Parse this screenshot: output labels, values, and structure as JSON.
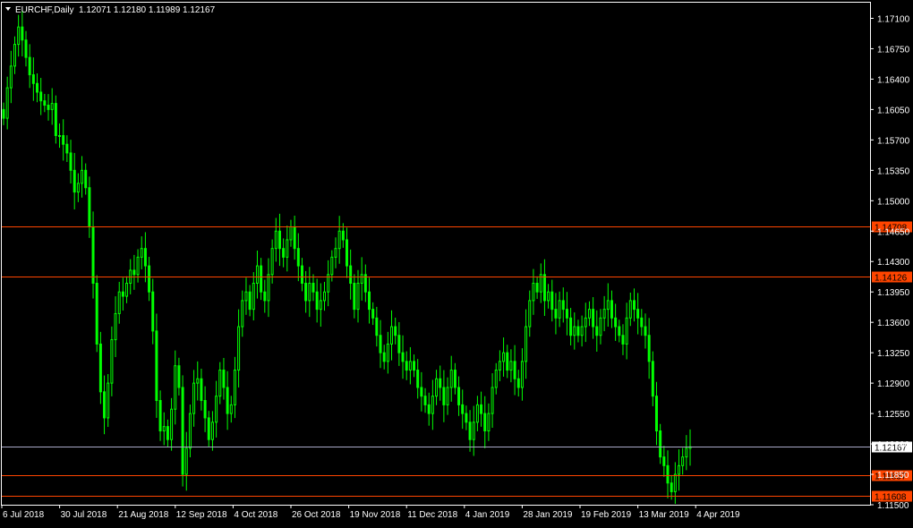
{
  "header": {
    "symbol_label": "EURCHF,Daily",
    "ohlc": "1.12071 1.12180 1.11989 1.12167"
  },
  "colors": {
    "background": "#000000",
    "frame": "#ffffff",
    "candle": "#00ff00",
    "text": "#ffffff",
    "resistance_line": "#ff4500",
    "current_price_line": "#a9a9c8",
    "tag_fill": "#ff4500",
    "current_tag_fill": "#ffffff"
  },
  "chart_data": {
    "type": "candlestick",
    "symbol": "EURCHF",
    "timeframe": "Daily",
    "ylim": [
      1.115,
      1.1728
    ],
    "y_ticks": [
      "1.17100",
      "1.16750",
      "1.16400",
      "1.16050",
      "1.15700",
      "1.15350",
      "1.15000",
      "1.14650",
      "1.14300",
      "1.13950",
      "1.13600",
      "1.13250",
      "1.12900",
      "1.12550",
      "1.12200",
      "1.11850",
      "1.11500"
    ],
    "x_ticks": [
      "6 Jul 2018",
      "30 Jul 2018",
      "21 Aug 2018",
      "12 Sep 2018",
      "4 Oct 2018",
      "26 Oct 2018",
      "19 Nov 2018",
      "11 Dec 2018",
      "4 Jan 2019",
      "28 Jan 2019",
      "19 Feb 2019",
      "13 Mar 2019",
      "4 Apr 2019"
    ],
    "horizontal_lines": [
      {
        "label": "1.14708",
        "price": 1.14708,
        "kind": "resistance"
      },
      {
        "label": "1.14126",
        "price": 1.14126,
        "kind": "resistance"
      },
      {
        "label": "1.12167",
        "price": 1.12167,
        "kind": "current"
      },
      {
        "label": "1.11837",
        "price": 1.11837,
        "kind": "support"
      },
      {
        "label": "1.11608",
        "price": 1.11608,
        "kind": "support"
      }
    ],
    "closes": [
      1.1595,
      1.163,
      1.1655,
      1.168,
      1.17,
      1.1685,
      1.1665,
      1.1645,
      1.1635,
      1.1625,
      1.1615,
      1.161,
      1.1605,
      1.1612,
      1.1575,
      1.1575,
      1.1565,
      1.1555,
      1.1535,
      1.151,
      1.152,
      1.1535,
      1.1515,
      1.147,
      1.1405,
      1.1335,
      1.128,
      1.125,
      1.129,
      1.134,
      1.137,
      1.1395,
      1.139,
      1.1405,
      1.142,
      1.1415,
      1.1435,
      1.1445,
      1.1425,
      1.1395,
      1.135,
      1.127,
      1.1235,
      1.124,
      1.1225,
      1.126,
      1.131,
      1.1285,
      1.1185,
      1.1215,
      1.1255,
      1.129,
      1.1295,
      1.127,
      1.125,
      1.1225,
      1.1245,
      1.1275,
      1.1305,
      1.1285,
      1.1255,
      1.1265,
      1.1305,
      1.1355,
      1.1385,
      1.1395,
      1.1375,
      1.1405,
      1.1425,
      1.1395,
      1.1385,
      1.1415,
      1.1445,
      1.1465,
      1.1445,
      1.1435,
      1.1455,
      1.147,
      1.1445,
      1.1425,
      1.1405,
      1.1385,
      1.1405,
      1.1395,
      1.1375,
      1.1385,
      1.1395,
      1.1415,
      1.1435,
      1.1445,
      1.1465,
      1.1455,
      1.1425,
      1.1405,
      1.1375,
      1.1405,
      1.1415,
      1.1395,
      1.1375,
      1.1365,
      1.1345,
      1.1325,
      1.1315,
      1.1335,
      1.1355,
      1.1345,
      1.1325,
      1.1315,
      1.1305,
      1.1315,
      1.1305,
      1.1285,
      1.1275,
      1.1265,
      1.1255,
      1.1275,
      1.1295,
      1.1285,
      1.1265,
      1.1285,
      1.1305,
      1.1285,
      1.1265,
      1.1255,
      1.1245,
      1.1225,
      1.1245,
      1.1265,
      1.1255,
      1.1235,
      1.1255,
      1.1285,
      1.1305,
      1.1315,
      1.1325,
      1.1305,
      1.1315,
      1.1295,
      1.1285,
      1.1315,
      1.1355,
      1.1385,
      1.1405,
      1.1395,
      1.1415,
      1.1385,
      1.1395,
      1.1375,
      1.1365,
      1.1385,
      1.1375,
      1.1365,
      1.1345,
      1.1355,
      1.1345,
      1.1355,
      1.1365,
      1.1375,
      1.1355,
      1.1345,
      1.1365,
      1.1375,
      1.1385,
      1.1365,
      1.1355,
      1.1345,
      1.1335,
      1.1365,
      1.1385,
      1.1375,
      1.1365,
      1.1355,
      1.1345,
      1.1315,
      1.1275,
      1.1235,
      1.1205,
      1.1195,
      1.1175,
      1.1165,
      1.1185,
      1.1195,
      1.1205,
      1.1215,
      1.12167
    ]
  }
}
